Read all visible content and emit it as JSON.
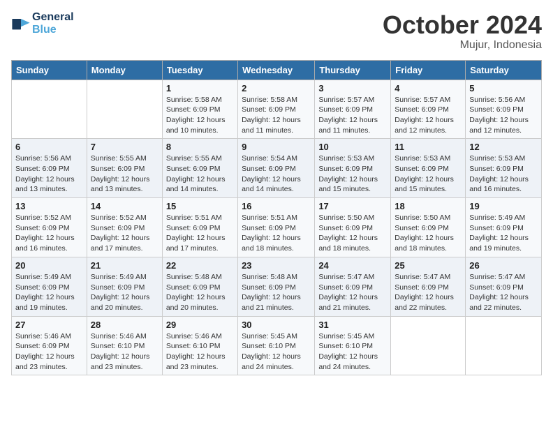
{
  "header": {
    "logo_line1": "General",
    "logo_line2": "Blue",
    "month": "October 2024",
    "location": "Mujur, Indonesia"
  },
  "weekdays": [
    "Sunday",
    "Monday",
    "Tuesday",
    "Wednesday",
    "Thursday",
    "Friday",
    "Saturday"
  ],
  "weeks": [
    [
      {
        "day": "",
        "sunrise": "",
        "sunset": "",
        "daylight": ""
      },
      {
        "day": "",
        "sunrise": "",
        "sunset": "",
        "daylight": ""
      },
      {
        "day": "1",
        "sunrise": "Sunrise: 5:58 AM",
        "sunset": "Sunset: 6:09 PM",
        "daylight": "Daylight: 12 hours and 10 minutes."
      },
      {
        "day": "2",
        "sunrise": "Sunrise: 5:58 AM",
        "sunset": "Sunset: 6:09 PM",
        "daylight": "Daylight: 12 hours and 11 minutes."
      },
      {
        "day": "3",
        "sunrise": "Sunrise: 5:57 AM",
        "sunset": "Sunset: 6:09 PM",
        "daylight": "Daylight: 12 hours and 11 minutes."
      },
      {
        "day": "4",
        "sunrise": "Sunrise: 5:57 AM",
        "sunset": "Sunset: 6:09 PM",
        "daylight": "Daylight: 12 hours and 12 minutes."
      },
      {
        "day": "5",
        "sunrise": "Sunrise: 5:56 AM",
        "sunset": "Sunset: 6:09 PM",
        "daylight": "Daylight: 12 hours and 12 minutes."
      }
    ],
    [
      {
        "day": "6",
        "sunrise": "Sunrise: 5:56 AM",
        "sunset": "Sunset: 6:09 PM",
        "daylight": "Daylight: 12 hours and 13 minutes."
      },
      {
        "day": "7",
        "sunrise": "Sunrise: 5:55 AM",
        "sunset": "Sunset: 6:09 PM",
        "daylight": "Daylight: 12 hours and 13 minutes."
      },
      {
        "day": "8",
        "sunrise": "Sunrise: 5:55 AM",
        "sunset": "Sunset: 6:09 PM",
        "daylight": "Daylight: 12 hours and 14 minutes."
      },
      {
        "day": "9",
        "sunrise": "Sunrise: 5:54 AM",
        "sunset": "Sunset: 6:09 PM",
        "daylight": "Daylight: 12 hours and 14 minutes."
      },
      {
        "day": "10",
        "sunrise": "Sunrise: 5:53 AM",
        "sunset": "Sunset: 6:09 PM",
        "daylight": "Daylight: 12 hours and 15 minutes."
      },
      {
        "day": "11",
        "sunrise": "Sunrise: 5:53 AM",
        "sunset": "Sunset: 6:09 PM",
        "daylight": "Daylight: 12 hours and 15 minutes."
      },
      {
        "day": "12",
        "sunrise": "Sunrise: 5:53 AM",
        "sunset": "Sunset: 6:09 PM",
        "daylight": "Daylight: 12 hours and 16 minutes."
      }
    ],
    [
      {
        "day": "13",
        "sunrise": "Sunrise: 5:52 AM",
        "sunset": "Sunset: 6:09 PM",
        "daylight": "Daylight: 12 hours and 16 minutes."
      },
      {
        "day": "14",
        "sunrise": "Sunrise: 5:52 AM",
        "sunset": "Sunset: 6:09 PM",
        "daylight": "Daylight: 12 hours and 17 minutes."
      },
      {
        "day": "15",
        "sunrise": "Sunrise: 5:51 AM",
        "sunset": "Sunset: 6:09 PM",
        "daylight": "Daylight: 12 hours and 17 minutes."
      },
      {
        "day": "16",
        "sunrise": "Sunrise: 5:51 AM",
        "sunset": "Sunset: 6:09 PM",
        "daylight": "Daylight: 12 hours and 18 minutes."
      },
      {
        "day": "17",
        "sunrise": "Sunrise: 5:50 AM",
        "sunset": "Sunset: 6:09 PM",
        "daylight": "Daylight: 12 hours and 18 minutes."
      },
      {
        "day": "18",
        "sunrise": "Sunrise: 5:50 AM",
        "sunset": "Sunset: 6:09 PM",
        "daylight": "Daylight: 12 hours and 18 minutes."
      },
      {
        "day": "19",
        "sunrise": "Sunrise: 5:49 AM",
        "sunset": "Sunset: 6:09 PM",
        "daylight": "Daylight: 12 hours and 19 minutes."
      }
    ],
    [
      {
        "day": "20",
        "sunrise": "Sunrise: 5:49 AM",
        "sunset": "Sunset: 6:09 PM",
        "daylight": "Daylight: 12 hours and 19 minutes."
      },
      {
        "day": "21",
        "sunrise": "Sunrise: 5:49 AM",
        "sunset": "Sunset: 6:09 PM",
        "daylight": "Daylight: 12 hours and 20 minutes."
      },
      {
        "day": "22",
        "sunrise": "Sunrise: 5:48 AM",
        "sunset": "Sunset: 6:09 PM",
        "daylight": "Daylight: 12 hours and 20 minutes."
      },
      {
        "day": "23",
        "sunrise": "Sunrise: 5:48 AM",
        "sunset": "Sunset: 6:09 PM",
        "daylight": "Daylight: 12 hours and 21 minutes."
      },
      {
        "day": "24",
        "sunrise": "Sunrise: 5:47 AM",
        "sunset": "Sunset: 6:09 PM",
        "daylight": "Daylight: 12 hours and 21 minutes."
      },
      {
        "day": "25",
        "sunrise": "Sunrise: 5:47 AM",
        "sunset": "Sunset: 6:09 PM",
        "daylight": "Daylight: 12 hours and 22 minutes."
      },
      {
        "day": "26",
        "sunrise": "Sunrise: 5:47 AM",
        "sunset": "Sunset: 6:09 PM",
        "daylight": "Daylight: 12 hours and 22 minutes."
      }
    ],
    [
      {
        "day": "27",
        "sunrise": "Sunrise: 5:46 AM",
        "sunset": "Sunset: 6:09 PM",
        "daylight": "Daylight: 12 hours and 23 minutes."
      },
      {
        "day": "28",
        "sunrise": "Sunrise: 5:46 AM",
        "sunset": "Sunset: 6:10 PM",
        "daylight": "Daylight: 12 hours and 23 minutes."
      },
      {
        "day": "29",
        "sunrise": "Sunrise: 5:46 AM",
        "sunset": "Sunset: 6:10 PM",
        "daylight": "Daylight: 12 hours and 23 minutes."
      },
      {
        "day": "30",
        "sunrise": "Sunrise: 5:45 AM",
        "sunset": "Sunset: 6:10 PM",
        "daylight": "Daylight: 12 hours and 24 minutes."
      },
      {
        "day": "31",
        "sunrise": "Sunrise: 5:45 AM",
        "sunset": "Sunset: 6:10 PM",
        "daylight": "Daylight: 12 hours and 24 minutes."
      },
      {
        "day": "",
        "sunrise": "",
        "sunset": "",
        "daylight": ""
      },
      {
        "day": "",
        "sunrise": "",
        "sunset": "",
        "daylight": ""
      }
    ]
  ]
}
